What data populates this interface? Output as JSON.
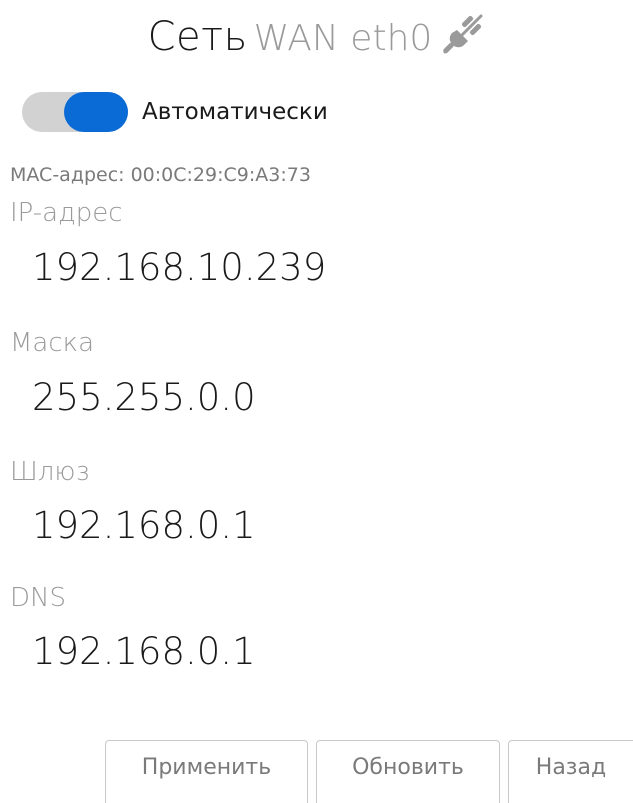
{
  "header": {
    "title": "Сеть",
    "subtitle": "WAN eth0",
    "icon": "plug-disconnected-icon"
  },
  "auto": {
    "label": "Автоматически",
    "enabled": true,
    "accent_color": "#0a6bd6"
  },
  "mac": {
    "text": "MAC-адрес: 00:0C:29:C9:A3:73"
  },
  "fields": {
    "ip": {
      "label": "IP-адрес",
      "value": "192.168.10.239"
    },
    "mask": {
      "label": "Маска",
      "value": "255.255.0.0"
    },
    "gateway": {
      "label": "Шлюз",
      "value": "192.168.0.1"
    },
    "dns": {
      "label": "DNS",
      "value": "192.168.0.1"
    }
  },
  "buttons": {
    "apply": "Применить",
    "refresh": "Обновить",
    "back": "Назад"
  }
}
